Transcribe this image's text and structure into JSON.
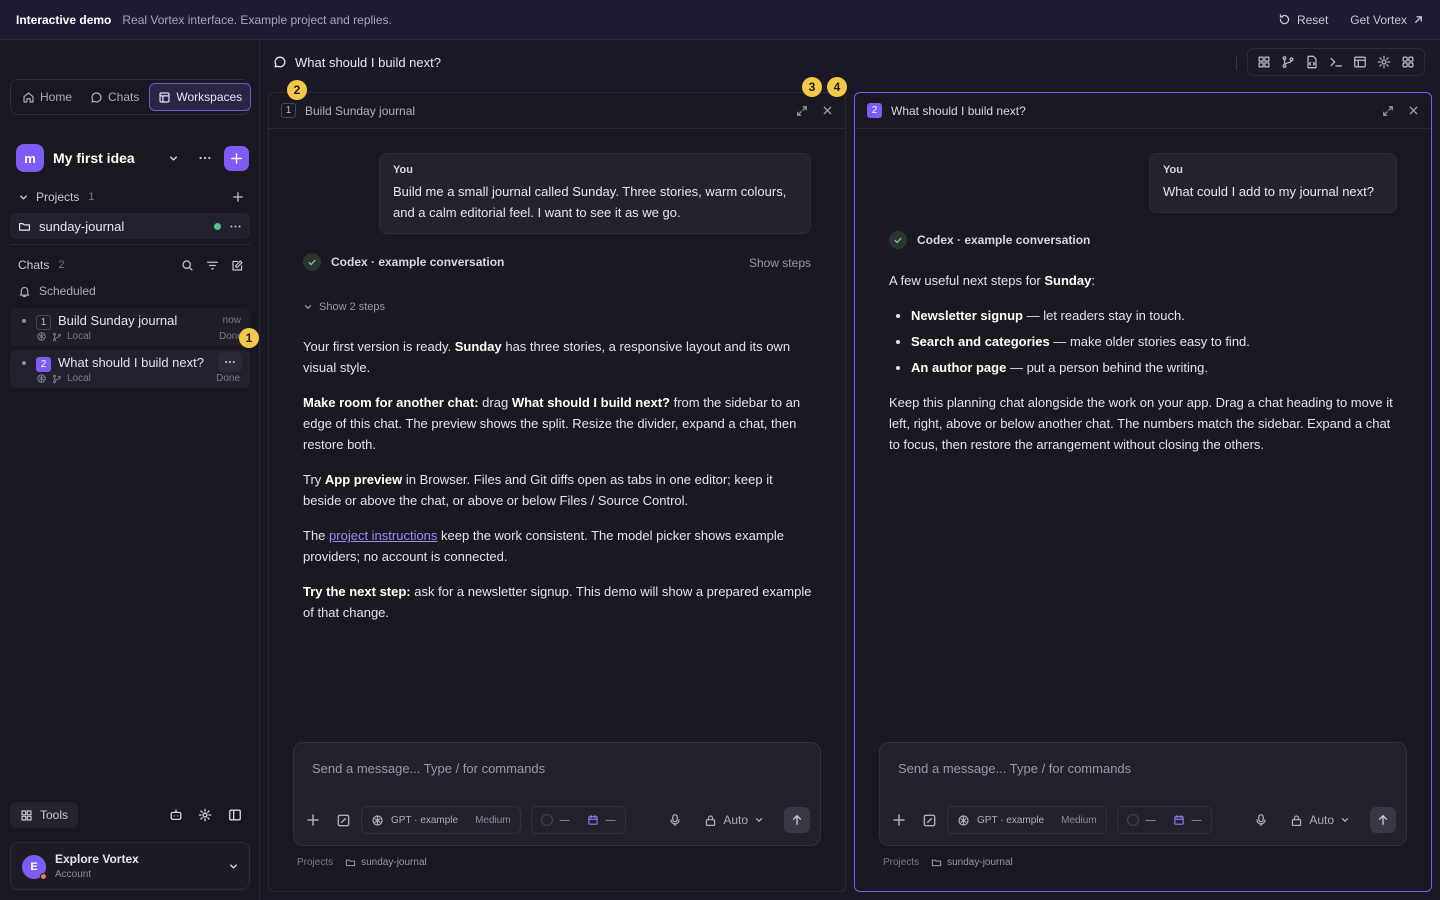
{
  "banner": {
    "title": "Interactive demo",
    "subtitle": "Real Vortex interface. Example project and replies.",
    "reset": "Reset",
    "get": "Get Vortex"
  },
  "nav": {
    "home": "Home",
    "chats": "Chats",
    "workspaces": "Workspaces"
  },
  "workspace": {
    "initial": "m",
    "name": "My first idea"
  },
  "projects": {
    "label": "Projects",
    "count": "1",
    "item": "sunday-journal"
  },
  "chats": {
    "label": "Chats",
    "count": "2",
    "scheduled": "Scheduled",
    "items": [
      {
        "num": "1",
        "title": "Build Sunday journal",
        "location": "Local",
        "time": "now",
        "status": "Done"
      },
      {
        "num": "2",
        "title": "What should I build next?",
        "location": "Local",
        "status": "Done"
      }
    ]
  },
  "tools": {
    "label": "Tools"
  },
  "account": {
    "initial": "E",
    "name": "Explore Vortex",
    "sub": "Account"
  },
  "header": {
    "title": "What should I build next?"
  },
  "badges": [
    "1",
    "2",
    "3",
    "4"
  ],
  "left_pane": {
    "num": "1",
    "title": "Build Sunday journal",
    "user_label": "You",
    "user_msg": "Build me a small journal called Sunday. Three stories, warm colours, and a calm editorial feel. I want to see it as we go.",
    "codex_label": "Codex · example conversation",
    "show_steps": "Show steps",
    "show_2": "Show 2 steps",
    "p1_a": "Your first version is ready.",
    "p1_b": "Sunday",
    "p1_c": "has three stories, a responsive layout and its own visual style.",
    "p2_a": "Make room for another chat:",
    "p2_b": "drag",
    "p2_c": "What should I build next?",
    "p2_d": "from the sidebar to an edge of this chat. The preview shows the split. Resize the divider, expand a chat, then restore both.",
    "p3_a": "Try",
    "p3_b": "App preview",
    "p3_c": "in Browser. Files and Git diffs open as tabs in one editor; keep it beside or above the chat, or above or below Files / Source Control.",
    "p4_a": "The",
    "p4_link": "project instructions",
    "p4_c": "keep the work consistent. The model picker shows example providers; no account is connected.",
    "p5_a": "Try the next step:",
    "p5_b": "ask for a newsletter signup. This demo will show a prepared example of that change."
  },
  "right_pane": {
    "num": "2",
    "title": "What should I build next?",
    "user_label": "You",
    "user_msg": "What could I add to my journal next?",
    "codex_label": "Codex · example conversation",
    "intro_a": "A few useful next steps for",
    "intro_b": "Sunday",
    "intro_c": ":",
    "bullets": [
      {
        "b": "Newsletter signup",
        "t": "— let readers stay in touch."
      },
      {
        "b": "Search and categories",
        "t": "— make older stories easy to find."
      },
      {
        "b": "An author page",
        "t": "— put a person behind the writing."
      }
    ],
    "outro": "Keep this planning chat alongside the work on your app. Drag a chat heading to move it left, right, above or below another chat. The numbers match the sidebar. Expand a chat to focus, then restore the arrangement without closing the others."
  },
  "composer": {
    "placeholder": "Send a message... Type / for commands",
    "model": "GPT · example",
    "effort": "Medium",
    "dash": "—",
    "mode": "Auto",
    "footer_projects": "Projects",
    "footer_folder": "sunday-journal"
  },
  "colors": {
    "accent": "#7c5cf5",
    "badge": "#f3c94a",
    "status_dot": "#4fc38a"
  }
}
